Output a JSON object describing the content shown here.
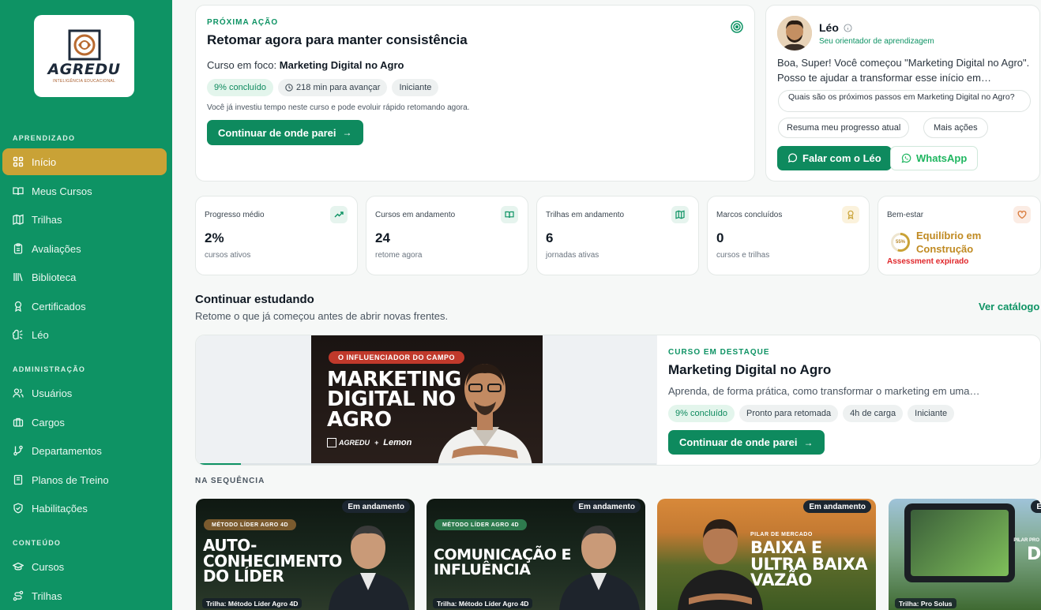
{
  "brand": {
    "name": "AGREDU",
    "tagline": "INTELIGÊNCIA EDUCACIONAL"
  },
  "sidebar": {
    "sections": [
      {
        "title": "APRENDIZADO",
        "items": [
          {
            "label": "Início",
            "icon": "grid-icon",
            "active": true
          },
          {
            "label": "Meus Cursos",
            "icon": "book-open-icon"
          },
          {
            "label": "Trilhas",
            "icon": "map-icon"
          },
          {
            "label": "Avaliações",
            "icon": "clipboard-icon"
          },
          {
            "label": "Biblioteca",
            "icon": "library-icon"
          },
          {
            "label": "Certificados",
            "icon": "award-icon"
          },
          {
            "label": "Léo",
            "icon": "brain-icon"
          }
        ]
      },
      {
        "title": "ADMINISTRAÇÃO",
        "items": [
          {
            "label": "Usuários",
            "icon": "users-icon"
          },
          {
            "label": "Cargos",
            "icon": "briefcase-icon"
          },
          {
            "label": "Departamentos",
            "icon": "git-branch-icon"
          },
          {
            "label": "Planos de Treino",
            "icon": "notebook-icon"
          },
          {
            "label": "Habilitações",
            "icon": "shield-icon"
          }
        ]
      },
      {
        "title": "CONTEÚDO",
        "items": [
          {
            "label": "Cursos",
            "icon": "graduation-cap-icon"
          },
          {
            "label": "Trilhas",
            "icon": "route-icon"
          }
        ]
      }
    ]
  },
  "next_action": {
    "eyebrow": "PRÓXIMA AÇÃO",
    "title": "Retomar agora para manter consistência",
    "focus_prefix": "Curso em foco:",
    "focus_course": "Marketing Digital no Agro",
    "chips": [
      "9% concluído",
      "218 min para avançar",
      "Iniciante"
    ],
    "note": "Você já investiu tempo neste curso e pode evoluir rápido retomando agora.",
    "button": "Continuar de onde parei"
  },
  "assistant": {
    "name": "Léo",
    "role": "Seu orientador de aprendizagem",
    "message": "Boa, Super! Você começou \"Marketing Digital no Agro\". Posso te ajudar a transformar esse início em…",
    "suggestions": [
      "Quais são os próximos passos em Marketing Digital no Agro?",
      "Resuma meu progresso atual",
      "Mais ações"
    ],
    "talk_button": "Falar com o Léo",
    "whatsapp_button": "WhatsApp"
  },
  "stats": [
    {
      "label": "Progresso médio",
      "value": "2%",
      "sub": "cursos ativos",
      "icon": "trending-up-icon"
    },
    {
      "label": "Cursos em andamento",
      "value": "24",
      "sub": "retome agora",
      "icon": "book-open-icon"
    },
    {
      "label": "Trilhas em andamento",
      "value": "6",
      "sub": "jornadas ativas",
      "icon": "map-icon"
    },
    {
      "label": "Marcos concluídos",
      "value": "0",
      "sub": "cursos e trilhas",
      "icon": "award-icon"
    }
  ],
  "wellbeing": {
    "label": "Bem-estar",
    "percent": "55%",
    "status": "Equilíbrio em Construção",
    "alert": "Assessment expirado",
    "icon": "heart-icon"
  },
  "continue": {
    "title": "Continuar estudando",
    "subtitle": "Retome o que já começou antes de abrir novas frentes.",
    "catalog_link": "Ver catálogo"
  },
  "featured": {
    "eyebrow": "CURSO EM DESTAQUE",
    "title": "Marketing Digital no Agro",
    "description": "Aprenda, de forma prática, como transformar o marketing em uma…",
    "chips": [
      "9% concluído",
      "Pronto para retomada",
      "4h de carga",
      "Iniciante"
    ],
    "button": "Continuar de onde parei",
    "progress": 0.09,
    "thumb_tag": "O INFLUENCIADOR DO CAMPO",
    "thumb_title": [
      "MARKETING",
      "DIGITAL NO",
      "AGRO"
    ],
    "thumb_logo": "AGREDU",
    "thumb_partner": "Lemon"
  },
  "sequence": {
    "title": "NA SEQUÊNCIA",
    "items": [
      {
        "badge": "Em andamento",
        "tag": "MÉTODO LÍDER AGRO 4D",
        "title": [
          "AUTO-",
          "CONHECIMENTO",
          "DO LÍDER"
        ],
        "trail": "Trilha: Método Líder Agro 4D"
      },
      {
        "badge": "Em andamento",
        "tag": "MÉTODO LÍDER AGRO 4D",
        "title": [
          "COMUNICAÇÃO E",
          "INFLUÊNCIA"
        ],
        "trail": "Trilha: Método Líder Agro 4D"
      },
      {
        "badge": "Em andamento",
        "tag": "PILAR DE MERCADO",
        "title": [
          "BAIXA E",
          "ULTRA BAIXA",
          "VAZÃO"
        ],
        "trail": ""
      },
      {
        "badge": "E",
        "tag": "PILAR PRO",
        "title": [
          "DUX"
        ],
        "trail": "Trilha: Pro Solus"
      }
    ]
  },
  "colors": {
    "primary": "#0e9364",
    "accent": "#c9a236",
    "danger": "#e0262a"
  }
}
